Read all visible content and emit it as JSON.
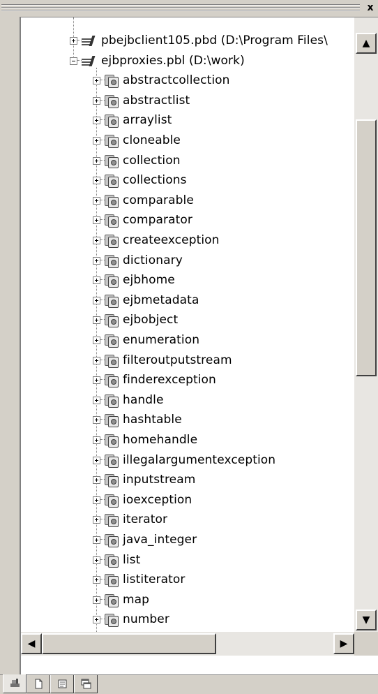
{
  "panel": {
    "close_glyph": "x",
    "tree": [
      {
        "label": "pbejbclient105.pbd (D:\\Program Files\\",
        "kind": "library",
        "expander": "plus"
      },
      {
        "label": "ejbproxies.pbl (D:\\work)",
        "kind": "library",
        "expander": "minus"
      },
      {
        "label": "abstractcollection",
        "kind": "object",
        "expander": "plus"
      },
      {
        "label": "abstractlist",
        "kind": "object",
        "expander": "plus"
      },
      {
        "label": "arraylist",
        "kind": "object",
        "expander": "plus"
      },
      {
        "label": "cloneable",
        "kind": "object",
        "expander": "plus"
      },
      {
        "label": "collection",
        "kind": "object",
        "expander": "plus"
      },
      {
        "label": "collections",
        "kind": "object",
        "expander": "plus"
      },
      {
        "label": "comparable",
        "kind": "object",
        "expander": "plus"
      },
      {
        "label": "comparator",
        "kind": "object",
        "expander": "plus"
      },
      {
        "label": "createexception",
        "kind": "object",
        "expander": "plus"
      },
      {
        "label": "dictionary",
        "kind": "object",
        "expander": "plus"
      },
      {
        "label": "ejbhome",
        "kind": "object",
        "expander": "plus"
      },
      {
        "label": "ejbmetadata",
        "kind": "object",
        "expander": "plus"
      },
      {
        "label": "ejbobject",
        "kind": "object",
        "expander": "plus"
      },
      {
        "label": "enumeration",
        "kind": "object",
        "expander": "plus"
      },
      {
        "label": "filteroutputstream",
        "kind": "object",
        "expander": "plus"
      },
      {
        "label": "finderexception",
        "kind": "object",
        "expander": "plus"
      },
      {
        "label": "handle",
        "kind": "object",
        "expander": "plus"
      },
      {
        "label": "hashtable",
        "kind": "object",
        "expander": "plus"
      },
      {
        "label": "homehandle",
        "kind": "object",
        "expander": "plus"
      },
      {
        "label": "illegalargumentexception",
        "kind": "object",
        "expander": "plus"
      },
      {
        "label": "inputstream",
        "kind": "object",
        "expander": "plus"
      },
      {
        "label": "ioexception",
        "kind": "object",
        "expander": "plus"
      },
      {
        "label": "iterator",
        "kind": "object",
        "expander": "plus"
      },
      {
        "label": "java_integer",
        "kind": "object",
        "expander": "plus"
      },
      {
        "label": "list",
        "kind": "object",
        "expander": "plus"
      },
      {
        "label": "listiterator",
        "kind": "object",
        "expander": "plus"
      },
      {
        "label": "map",
        "kind": "object",
        "expander": "plus"
      },
      {
        "label": "number",
        "kind": "object",
        "expander": "plus"
      }
    ],
    "scrollbars": {
      "up_glyph": "▲",
      "down_glyph": "▼",
      "left_glyph": "◀",
      "right_glyph": "▶"
    },
    "tabs": [
      {
        "name": "library-tab",
        "icon": "library-painter-icon",
        "active": true
      },
      {
        "name": "document-tab",
        "icon": "document-icon",
        "active": false
      },
      {
        "name": "notes-tab",
        "icon": "notes-icon",
        "active": false
      },
      {
        "name": "windows-tab",
        "icon": "windows-icon",
        "active": false
      }
    ]
  }
}
